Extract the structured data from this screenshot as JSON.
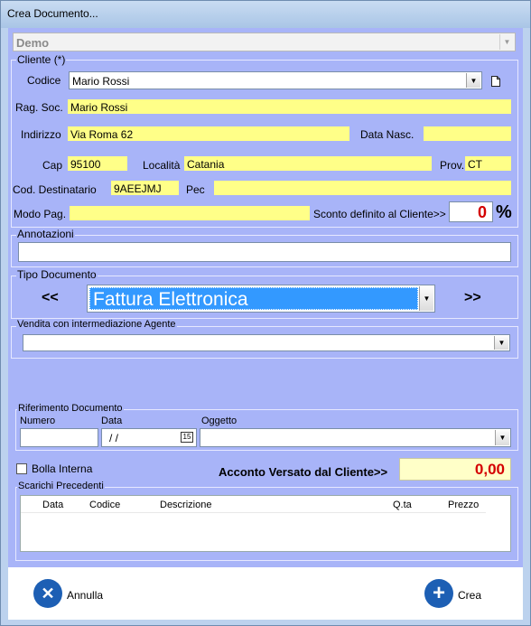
{
  "window": {
    "title": "Crea Documento..."
  },
  "company": {
    "value": "Demo"
  },
  "cliente": {
    "group_label": "Cliente (*)",
    "codice_label": "Codice",
    "codice_value": "Mario Rossi",
    "ragsoc_label": "Rag. Soc.",
    "ragsoc_value": "Mario Rossi",
    "indirizzo_label": "Indirizzo",
    "indirizzo_value": "Via Roma 62",
    "datanasc_label": "Data Nasc.",
    "datanasc_value": "",
    "cap_label": "Cap",
    "cap_value": "95100",
    "localita_label": "Località",
    "localita_value": "Catania",
    "prov_label": "Prov.",
    "prov_value": "CT",
    "coddest_label": "Cod. Destinatario",
    "coddest_value": "9AEEJMJ",
    "pec_label": "Pec",
    "pec_value": "",
    "modopag_label": "Modo Pag.",
    "modopag_value": "",
    "sconto_label": "Sconto definito al Cliente>>",
    "sconto_value": "0",
    "sconto_unit": "%"
  },
  "annotazioni": {
    "label": "Annotazioni",
    "value": ""
  },
  "tipo_documento": {
    "label": "Tipo Documento",
    "prev": "<<",
    "next": ">>",
    "selected": "Fattura Elettronica"
  },
  "vendita": {
    "label": "Vendita con intermediazione Agente",
    "value": ""
  },
  "riferimento": {
    "label": "Riferimento Documento",
    "numero_label": "Numero",
    "numero_value": "",
    "data_label": "Data",
    "data_value": " /  /",
    "oggetto_label": "Oggetto",
    "oggetto_value": "",
    "calendar_day": "15"
  },
  "bolla_interna": {
    "label": "Bolla Interna",
    "checked": false
  },
  "acconto": {
    "label": "Acconto Versato dal  Cliente>>",
    "value": "0,00"
  },
  "scarichi": {
    "label": "Scarichi Precedenti",
    "columns": [
      "Data",
      "Codice",
      "Descrizione",
      "Q.ta",
      "Prezzo"
    ]
  },
  "buttons": {
    "annulla": "Annulla",
    "crea": "Crea"
  },
  "colors": {
    "form_bg": "#a8b4f8",
    "field_yellow": "#ffff88",
    "accent_red": "#d40000",
    "selection_blue": "#3399ff"
  }
}
